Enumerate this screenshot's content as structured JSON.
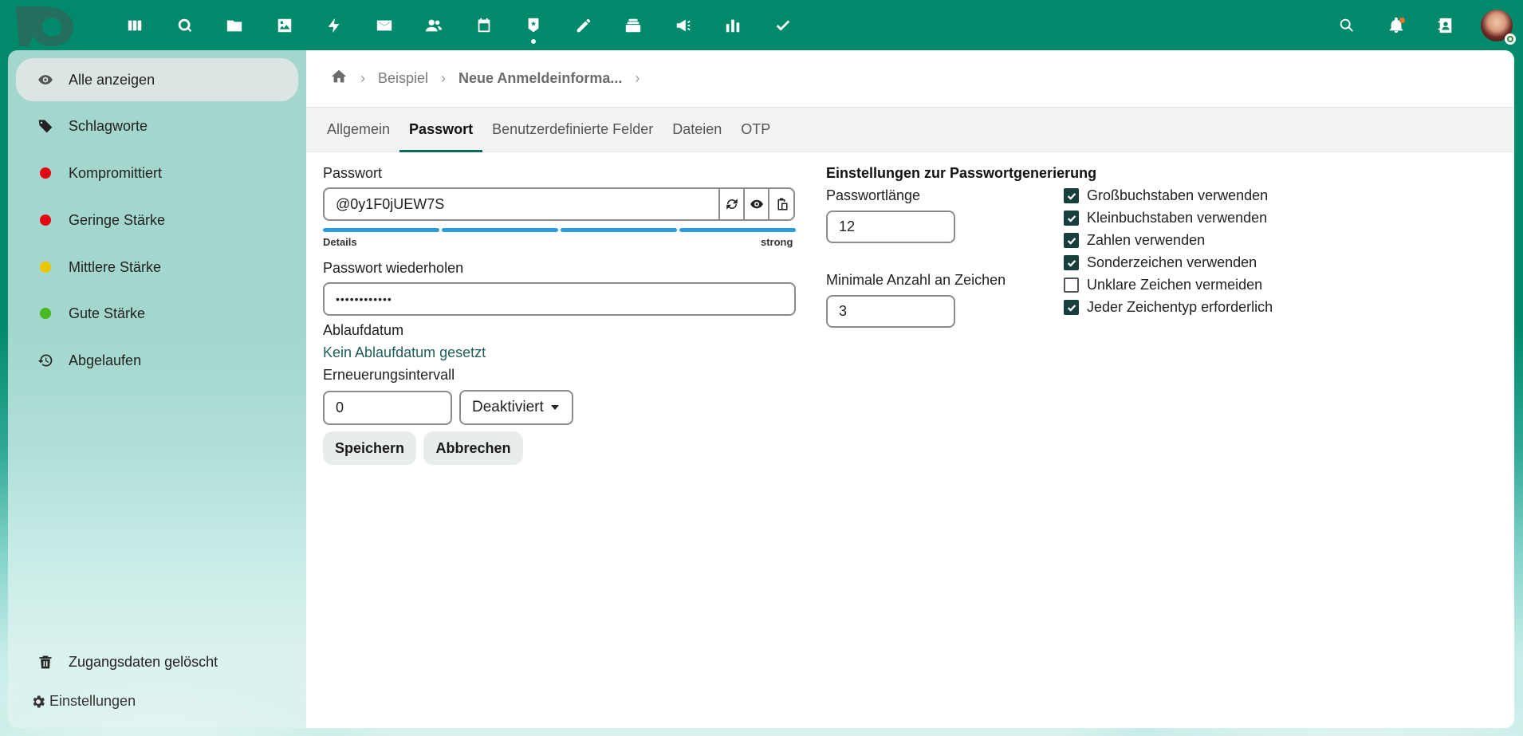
{
  "header": {
    "apps": [
      {
        "name": "dashboard-icon"
      },
      {
        "name": "search-app-icon"
      },
      {
        "name": "files-icon"
      },
      {
        "name": "photos-icon"
      },
      {
        "name": "activity-icon"
      },
      {
        "name": "mail-icon"
      },
      {
        "name": "contacts-icon"
      },
      {
        "name": "calendar-icon"
      },
      {
        "name": "passwords-icon",
        "active": true
      },
      {
        "name": "notes-icon"
      },
      {
        "name": "deck-icon"
      },
      {
        "name": "announcements-icon"
      },
      {
        "name": "analytics-icon"
      },
      {
        "name": "tasks-icon"
      }
    ]
  },
  "sidebar": {
    "items": [
      {
        "label": "Alle anzeigen",
        "icon": "eye-icon",
        "active": true
      },
      {
        "label": "Schlagworte",
        "icon": "tag-icon"
      },
      {
        "label": "Kompromittiert",
        "icon": "red-dot",
        "color": "#e30613"
      },
      {
        "label": "Geringe Stärke",
        "icon": "red-dot",
        "color": "#e30613"
      },
      {
        "label": "Mittlere Stärke",
        "icon": "yellow-dot",
        "color": "#eac500"
      },
      {
        "label": "Gute Stärke",
        "icon": "green-dot",
        "color": "#46ba1e"
      },
      {
        "label": "Abgelaufen",
        "icon": "history-icon"
      }
    ],
    "deleted_label": "Zugangsdaten gelöscht",
    "settings_label": "Einstellungen"
  },
  "breadcrumb": {
    "items": [
      "Beispiel"
    ],
    "current": "Neue Anmeldeinforma..."
  },
  "tabs": [
    "Allgemein",
    "Passwort",
    "Benutzerdefinierte Felder",
    "Dateien",
    "OTP"
  ],
  "form": {
    "password_label": "Passwort",
    "password_value": "@0y1F0jUEW7S",
    "strength_details": "Details",
    "strength_value": "strong",
    "strength_level": 1.0,
    "repeat_label": "Passwort wiederholen",
    "repeat_value": "••••••••••••",
    "expiry_label": "Ablaufdatum",
    "expiry_link": "Kein Ablaufdatum gesetzt",
    "renewal_label": "Erneuerungsintervall",
    "renewal_value": "0",
    "renewal_unit": "Deaktiviert",
    "save_label": "Speichern",
    "cancel_label": "Abbrechen"
  },
  "generator": {
    "title": "Einstellungen zur Passwortgenerierung",
    "length_label": "Passwortlänge",
    "length_value": "12",
    "min_label": "Minimale Anzahl an Zeichen",
    "min_value": "3",
    "options": [
      {
        "label": "Großbuchstaben verwenden",
        "checked": true
      },
      {
        "label": "Kleinbuchstaben verwenden",
        "checked": true
      },
      {
        "label": "Zahlen verwenden",
        "checked": true
      },
      {
        "label": "Sonderzeichen verwenden",
        "checked": true
      },
      {
        "label": "Unklare Zeichen vermeiden",
        "checked": false
      },
      {
        "label": "Jeder Zeichentyp erforderlich",
        "checked": true
      }
    ]
  },
  "colors": {
    "brand": "#00896b",
    "accent": "#0b6b5a",
    "strength": "#2d9cdb"
  }
}
